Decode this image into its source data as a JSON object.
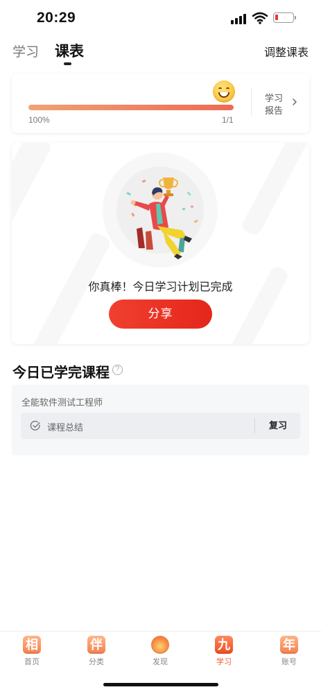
{
  "status_bar": {
    "time": "20:29"
  },
  "header": {
    "tabs": [
      {
        "label": "学习",
        "active": false
      },
      {
        "label": "课表",
        "active": true
      }
    ],
    "adjust_label": "调整课表"
  },
  "progress": {
    "fraction": 1.0,
    "percent_label": "100%",
    "ratio_label": "1/1",
    "report_label": "学习报告"
  },
  "completion": {
    "message": "你真棒！今日学习计划已完成",
    "share_label": "分享"
  },
  "section": {
    "title": "今日已学完课程"
  },
  "course": {
    "name": "全能软件测试工程师",
    "item_label": "课程总结",
    "review_label": "复习"
  },
  "tabbar": {
    "items": [
      {
        "glyph": "相",
        "label": "首页",
        "active": false
      },
      {
        "glyph": "伴",
        "label": "分类",
        "active": false
      },
      {
        "glyph": "",
        "label": "发现",
        "active": false
      },
      {
        "glyph": "九",
        "label": "学习",
        "active": true
      },
      {
        "glyph": "年",
        "label": "账号",
        "active": false
      }
    ]
  },
  "colors": {
    "accent": "#ee3a2a",
    "progress_start": "#f1a272",
    "progress_end": "#ee6a55",
    "tab_active": "#f25a2c"
  },
  "icons": [
    "cellular-signal-icon",
    "wifi-icon",
    "battery-icon",
    "smiley-icon",
    "chevron-right-icon",
    "help-icon",
    "check-circle-icon",
    "trophy-illustration"
  ]
}
